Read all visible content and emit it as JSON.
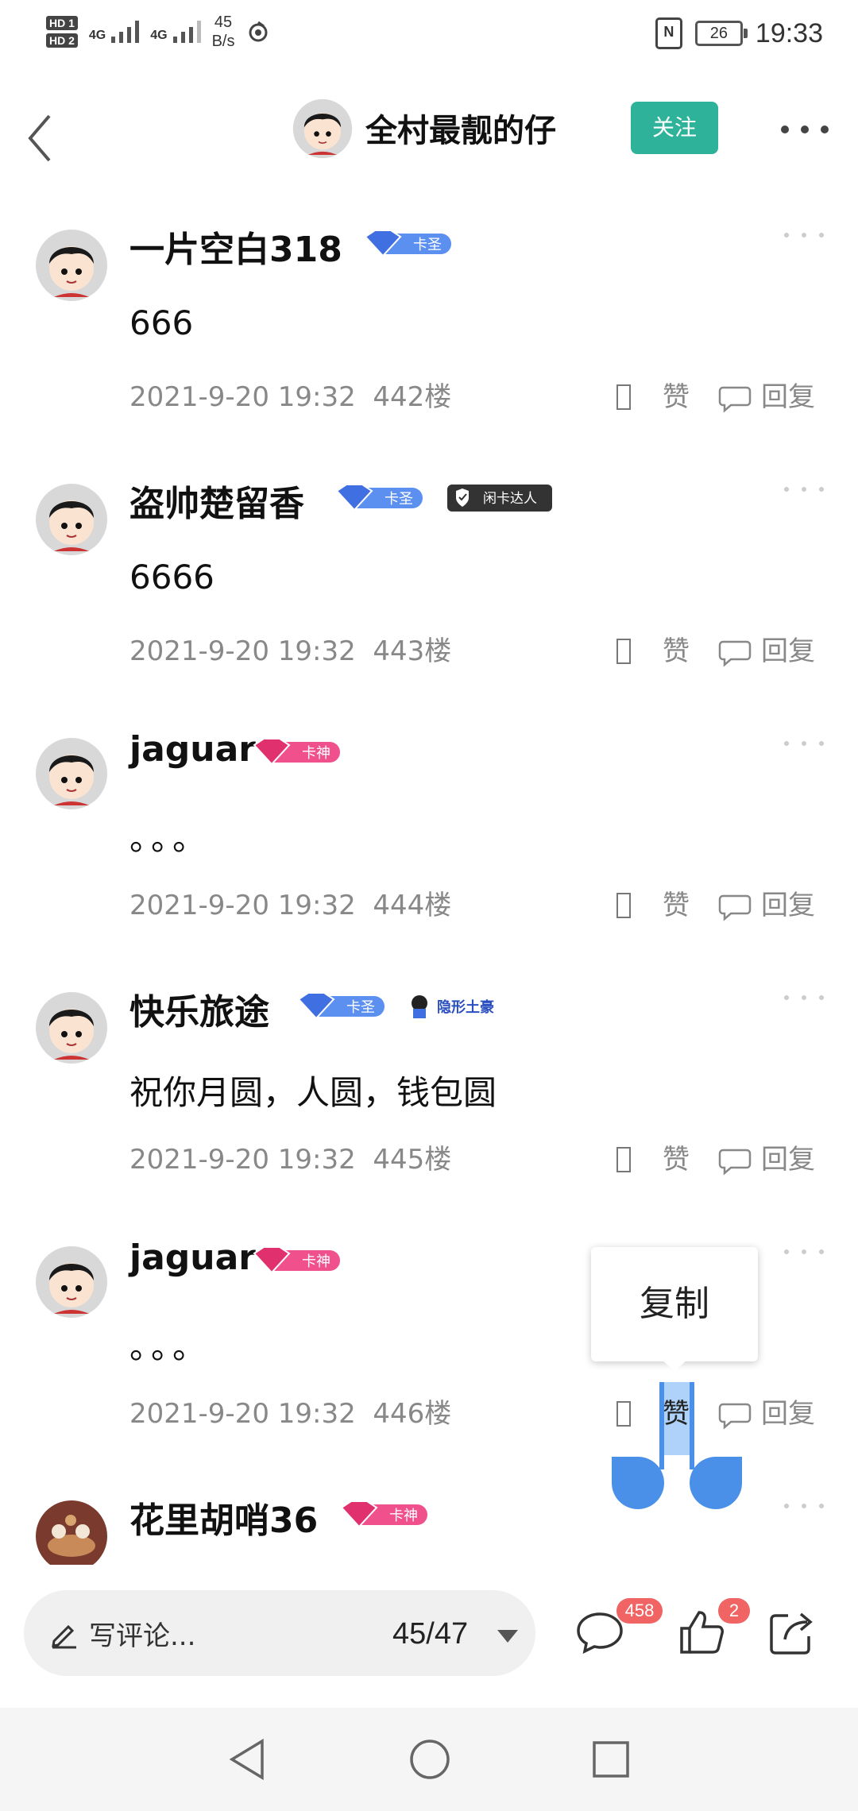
{
  "status_bar": {
    "hd1": "HD 1",
    "hd2": "HD 2",
    "net1": "4G",
    "net2": "4G",
    "speed_value": "45",
    "speed_unit": "B/s",
    "nfc": "N",
    "battery": "26",
    "time": "19:33"
  },
  "header": {
    "title": "全村最靓的仔",
    "follow_label": "关注"
  },
  "posts": [
    {
      "username": "一片空白318",
      "badge": "卡圣",
      "content": "666",
      "timestamp": "2021-9-20 19:32",
      "floor": "442楼",
      "like": "赞",
      "reply": "回复"
    },
    {
      "username": "盗帅楚留香",
      "badge": "卡圣",
      "badge2": "闲卡达人",
      "content": "6666",
      "timestamp": "2021-9-20 19:32",
      "floor": "443楼",
      "like": "赞",
      "reply": "回复"
    },
    {
      "username": "jaguar",
      "badge": "卡神",
      "content": "。。。",
      "timestamp": "2021-9-20 19:32",
      "floor": "444楼",
      "like": "赞",
      "reply": "回复"
    },
    {
      "username": "快乐旅途",
      "badge": "卡圣",
      "badge2": "隐形土豪",
      "content": "祝你月圆，人圆，钱包圆",
      "timestamp": "2021-9-20 19:32",
      "floor": "445楼",
      "like": "赞",
      "reply": "回复"
    },
    {
      "username": "jaguar",
      "badge": "卡神",
      "content": "。。。",
      "timestamp": "2021-9-20 19:32",
      "floor": "446楼",
      "like": "赞",
      "reply": "回复"
    },
    {
      "username": "花里胡哨36",
      "badge": "卡神"
    }
  ],
  "context_menu": {
    "copy_label": "复制"
  },
  "bottom_bar": {
    "comment_placeholder": "写评论...",
    "page_indicator": "45/47",
    "comment_count": "458",
    "like_count": "2"
  },
  "colors": {
    "accent": "#2eb39a",
    "badge_red": "#f06464",
    "selection": "#4a90e8",
    "badge_blue": "#5b8ff0",
    "badge_pink": "#f0508c"
  }
}
